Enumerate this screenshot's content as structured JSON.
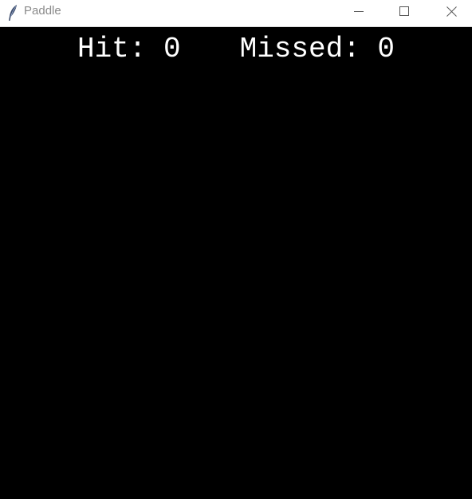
{
  "window": {
    "title": "Paddle",
    "icon": "feather-icon",
    "controls": {
      "minimize_icon": "minimize-icon",
      "maximize_icon": "maximize-icon",
      "close_icon": "close-icon"
    }
  },
  "game": {
    "background_color": "#000000",
    "text_color": "#ffffff",
    "hit_label": "Hit: 0",
    "missed_label": "Missed: 0"
  }
}
